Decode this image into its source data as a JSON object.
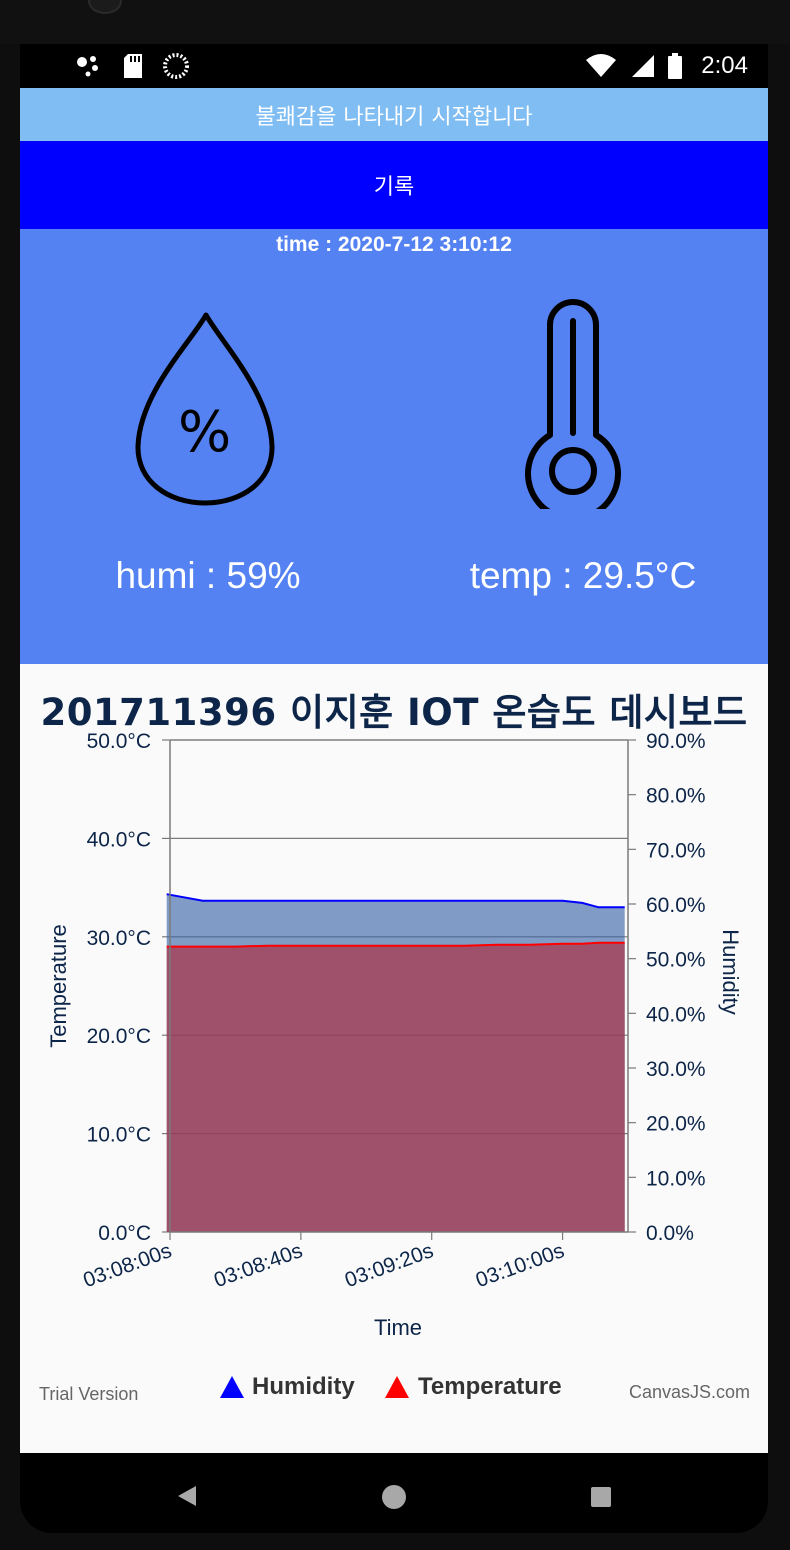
{
  "status_bar": {
    "time": "2:04"
  },
  "banner": {
    "text": "불쾌감을 나타내기 시작합니다"
  },
  "record_button": {
    "label": "기록"
  },
  "sensor": {
    "time_text": "time : 2020-7-12 3:10:12",
    "humi_text": "humi : 59%",
    "temp_text": "temp : 29.5°C"
  },
  "icons": [
    "humidity-drop-icon",
    "thermometer-icon",
    "back-icon",
    "home-icon",
    "recents-icon",
    "wifi-icon",
    "signal-icon",
    "battery-icon"
  ],
  "colors": {
    "banner": "#7fbdf3",
    "button": "#0000ff",
    "panel": "#5582f2",
    "humidity": "#0000ff",
    "temperature": "#ff0000"
  },
  "chart_data": {
    "type": "area",
    "title": "201711396 이지훈 IOT 온습도 데시보드",
    "xlabel": "Time",
    "ylabel": "Temperature",
    "y2label": "Humidity",
    "x_ticks": [
      "03:08:00s",
      "03:08:40s",
      "03:09:20s",
      "03:10:00s"
    ],
    "y_ticks": [
      "0.0°C",
      "10.0°C",
      "20.0°C",
      "30.0°C",
      "40.0°C",
      "50.0°C"
    ],
    "y2_ticks": [
      "0.0%",
      "10.0%",
      "20.0%",
      "30.0%",
      "40.0%",
      "50.0%",
      "60.0%",
      "70.0%",
      "80.0%",
      "90.0%"
    ],
    "ylim": [
      0,
      50
    ],
    "y2lim": [
      0,
      90
    ],
    "xlim_seconds": [
      0,
      140
    ],
    "x": [
      -1,
      10,
      20,
      30,
      40,
      50,
      60,
      70,
      80,
      90,
      100,
      110,
      120,
      126,
      131,
      139
    ],
    "series": [
      {
        "name": "Humidity",
        "axis": "y2",
        "color": "#0000ff",
        "fill": "rgba(53,97,165,0.62)",
        "values": [
          61.8,
          60.6,
          60.6,
          60.6,
          60.6,
          60.6,
          60.6,
          60.6,
          60.6,
          60.6,
          60.6,
          60.6,
          60.6,
          60.2,
          59.4,
          59.4
        ]
      },
      {
        "name": "Temperature",
        "axis": "y",
        "color": "#ff0000",
        "fill": "rgba(170,52,72,0.72)",
        "values": [
          29.0,
          29.0,
          29.0,
          29.1,
          29.1,
          29.1,
          29.1,
          29.1,
          29.1,
          29.1,
          29.2,
          29.2,
          29.3,
          29.3,
          29.4,
          29.4
        ]
      }
    ],
    "legend": [
      "Humidity",
      "Temperature"
    ],
    "legend_position": "bottom",
    "grid": true,
    "watermark_left": "Trial Version",
    "watermark_right": "CanvasJS.com"
  }
}
